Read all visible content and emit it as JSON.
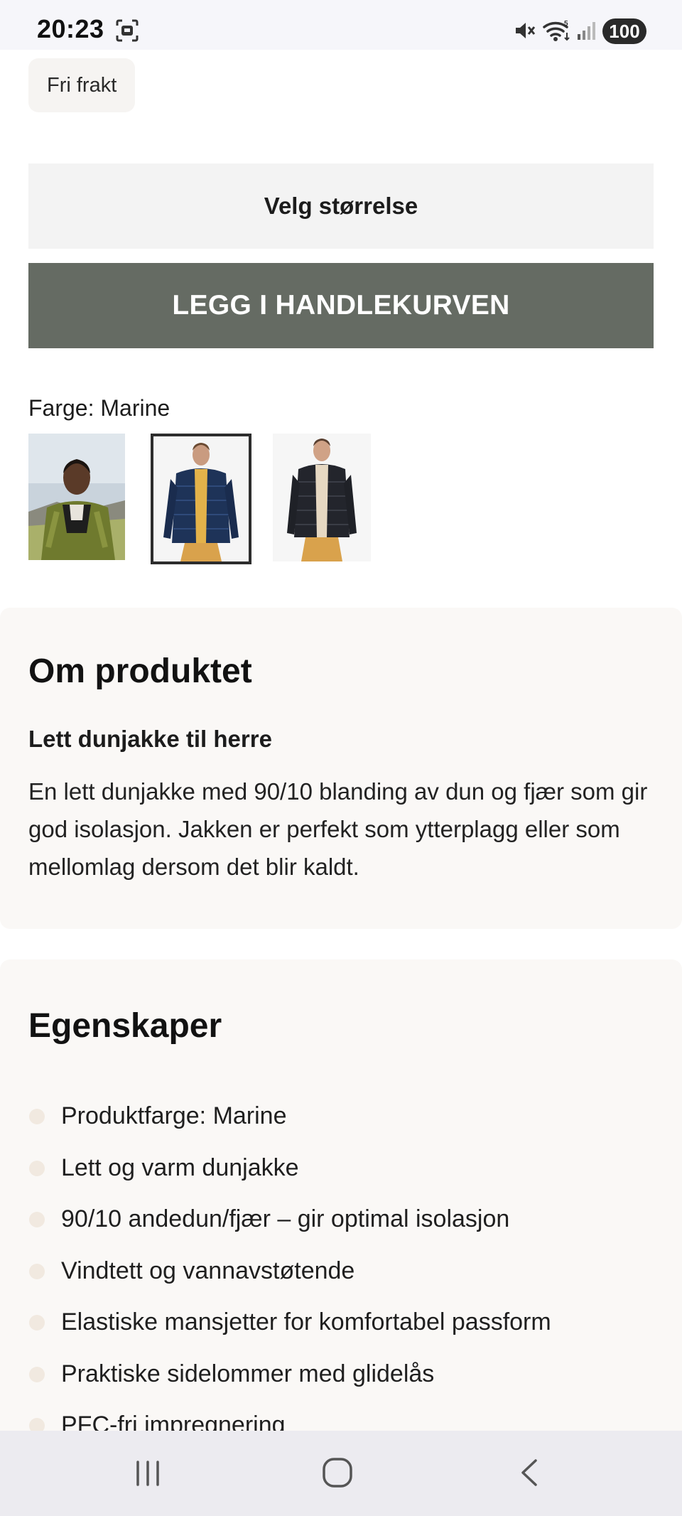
{
  "status_bar": {
    "time": "20:23",
    "battery": "100",
    "icons": [
      "screenshot-icon",
      "mute-icon",
      "wifi-icon",
      "signal-icon"
    ]
  },
  "chip": {
    "label": "Fri frakt"
  },
  "size_select": {
    "label": "Velg størrelse"
  },
  "cart_button": {
    "label": "LEGG I HANDLEKURVEN",
    "color": "#656b63"
  },
  "color_picker": {
    "label": "Farge: Marine",
    "swatches": [
      "olive-jacket-photo",
      "navy-jacket-photo",
      "black-jacket-photo"
    ],
    "selected_index": 1
  },
  "about": {
    "title": "Om produktet",
    "subtitle": "Lett dunjakke til herre",
    "text": "En lett dunjakke med 90/10 blanding av dun og fjær som gir god isolasjon. Jakken er perfekt som ytterplagg eller som mellomlag dersom det blir kaldt."
  },
  "features": {
    "title": "Egenskaper",
    "items": [
      "Produktfarge: Marine",
      "Lett og varm dunjakke",
      "90/10 andedun/fjær – gir optimal isolasjon",
      "Vindtett og vannavstøtende",
      "Elastiske mansjetter for komfortabel passform",
      "Praktiske sidelommer med glidelås",
      "PFC-fri impregnering"
    ]
  },
  "nav_bar": {
    "icons": [
      "recents-icon",
      "home-icon",
      "back-icon"
    ]
  }
}
